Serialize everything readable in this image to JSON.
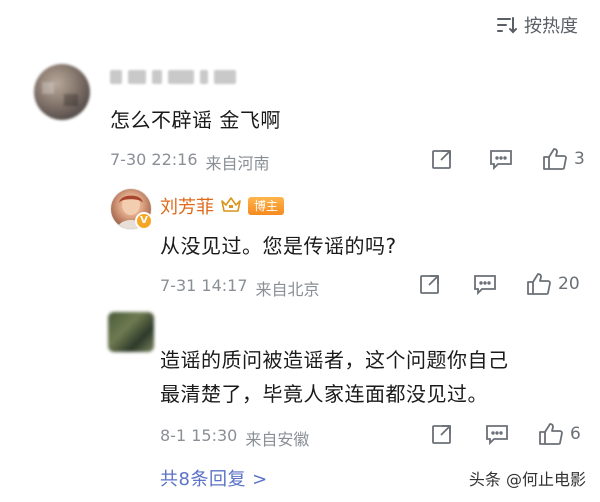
{
  "sort": {
    "label": "按热度",
    "icon": "sort-icon"
  },
  "comments": [
    {
      "username": "",
      "text": "怎么不辟谣 金飞啊",
      "time": "7-30 22:16",
      "location": "来自河南",
      "likes": "3"
    }
  ],
  "replies": [
    {
      "username": "刘芳菲",
      "badge": "博主",
      "text": "从没见过。您是传谣的吗?",
      "time": "7-31 14:17",
      "location": "来自北京",
      "likes": "20"
    },
    {
      "username": "",
      "text_line1": "造谣的质问被造谣者，这个问题你自己",
      "text_line2": "最清楚了，毕竟人家连面都没见过。",
      "time": "8-1 15:30",
      "location": "来自安徽",
      "likes": "6"
    }
  ],
  "reply_summary": "共8条回复 >",
  "watermark": "头条 @何止电影",
  "colors": {
    "accent_name": "#e06a1b",
    "link": "#5a72c7",
    "meta": "#8a8f96",
    "badge": "#f48a1f"
  }
}
